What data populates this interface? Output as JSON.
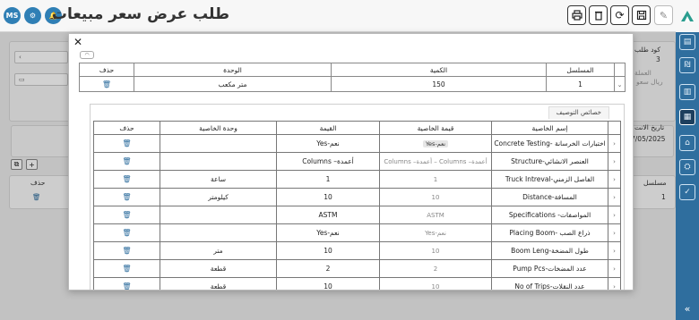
{
  "header": {
    "title": "طلب عرض سعر مبيعات",
    "avatar_initials": "MS",
    "tool_icons": [
      "edit-icon",
      "save-icon",
      "refresh-icon",
      "delete-icon",
      "print-icon"
    ]
  },
  "background": {
    "code_label": "كود طلب",
    "code_value": "3",
    "currency_label": "العملة",
    "currency_value": "ريال سعو",
    "date_label": "تاريخ الانت",
    "date_value": "7/05/2025",
    "grid_delete_header": "حذف",
    "grid_serial_header": "مسلسل",
    "grid_serial_value": "1",
    "add_button": "+"
  },
  "modal": {
    "close_label": "✕",
    "unit_table": {
      "headers": {
        "serial": "المسلسل",
        "quantity": "الكمية",
        "unit": "الوحدة",
        "delete": "حذف"
      },
      "row": {
        "serial": "1",
        "quantity": "150",
        "unit": "متر مكعب"
      }
    },
    "sub_tab": "خصائص التوصيف",
    "prop_table": {
      "headers": {
        "name": "إسم الخاصية",
        "value_input": "قيمة الخاصية",
        "value": "القيمة",
        "unit": "وحدة الخاصية",
        "delete": "حذف"
      },
      "rows": [
        {
          "name": "اختبارات الخرسانة -Concrete Testing",
          "value_input": "نعم-Yes",
          "value_chip": true,
          "value": "نعم-Yes",
          "unit": ""
        },
        {
          "name": "العنصر الانشائي-Structure",
          "value_input": "أعمدة– Columns – أعمدة– Columns",
          "value_chip": false,
          "value": "أعمدة– Columns",
          "unit": ""
        },
        {
          "name": "الفاصل الزمني-Truck Intreval",
          "value_input": "1",
          "value_chip": false,
          "value": "1",
          "unit": "ساعة"
        },
        {
          "name": "المسافة-Distance",
          "value_input": "10",
          "value_chip": false,
          "value": "10",
          "unit": "كيلومتر"
        },
        {
          "name": "المواصفات- Specifications",
          "value_input": "ASTM",
          "value_chip": false,
          "value": "ASTM",
          "unit": ""
        },
        {
          "name": "ذراع الصب -Placing Boom",
          "value_input": "نعم-Yes",
          "value_chip": false,
          "value": "نعم-Yes",
          "unit": ""
        },
        {
          "name": "طول المضخة-Boom Leng",
          "value_input": "10",
          "value_chip": false,
          "value": "10",
          "unit": "متر"
        },
        {
          "name": "عدد المضخات-Pump Pcs",
          "value_input": "2",
          "value_chip": false,
          "value": "2",
          "unit": "قطعة"
        },
        {
          "name": "عدد النقلات-No of Trips",
          "value_input": "10",
          "value_chip": false,
          "value": "10",
          "unit": "قطعة"
        }
      ]
    }
  },
  "colors": {
    "accent": "#2f6e9e",
    "rail": "#2f6e9e",
    "avatar": "#2f7fb5"
  }
}
